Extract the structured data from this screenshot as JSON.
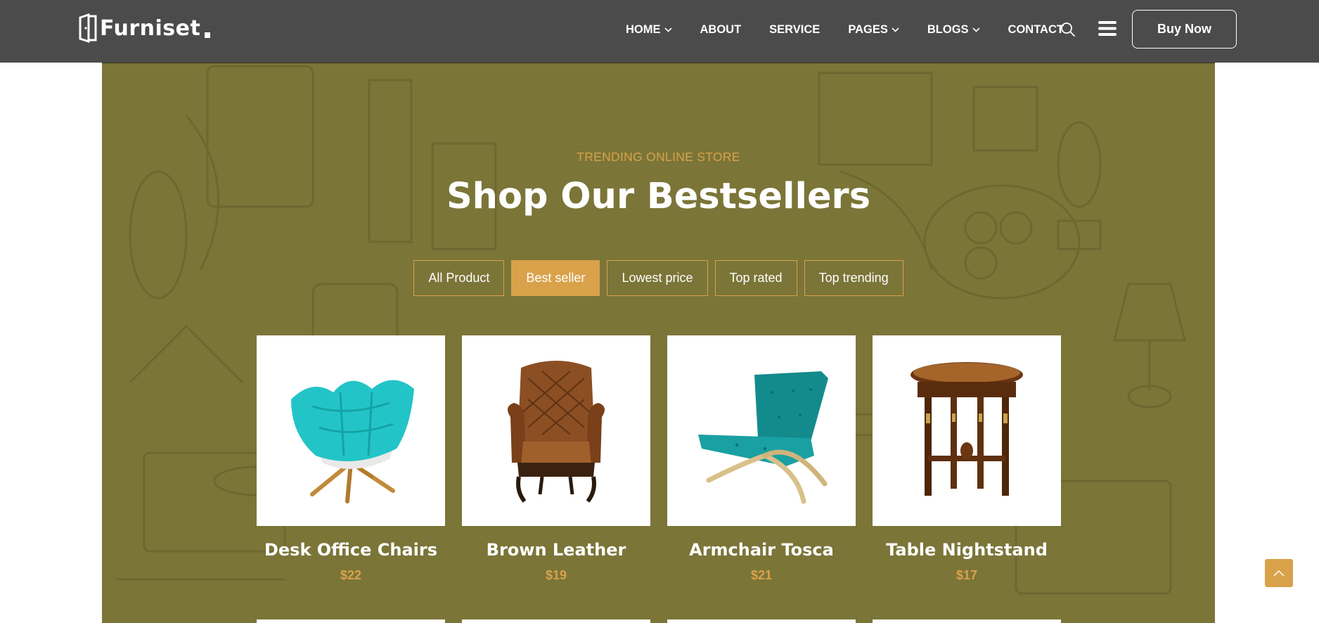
{
  "brand": {
    "name": "Furniset",
    "accent": "#d9a24a",
    "header_bg": "#4b4b4b",
    "section_bg": "#7b7538"
  },
  "nav": {
    "items": [
      {
        "label": "HOME",
        "has_dropdown": true
      },
      {
        "label": "ABOUT",
        "has_dropdown": false
      },
      {
        "label": "SERVICE",
        "has_dropdown": false
      },
      {
        "label": "PAGES",
        "has_dropdown": true
      },
      {
        "label": "BLOGS",
        "has_dropdown": true
      },
      {
        "label": "CONTACT",
        "has_dropdown": false
      }
    ],
    "icons": [
      "search-icon",
      "hamburger-menu-icon"
    ],
    "cta_label": "Buy Now"
  },
  "section": {
    "eyebrow": "TRENDING ONLINE STORE",
    "title": "Shop Our Bestsellers",
    "filters": [
      {
        "label": "All Product",
        "active": false
      },
      {
        "label": "Best seller",
        "active": true
      },
      {
        "label": "Lowest price",
        "active": false
      },
      {
        "label": "Top rated",
        "active": false
      },
      {
        "label": "Top trending",
        "active": false
      }
    ],
    "products": [
      {
        "name": "Desk Office Chairs",
        "price": "$22",
        "icon": "turquoise-lounge-chair"
      },
      {
        "name": "Brown Leather",
        "price": "$19",
        "icon": "leather-armchair"
      },
      {
        "name": "Armchair Tosca",
        "price": "$21",
        "icon": "teal-cantilever-chair"
      },
      {
        "name": "Table Nightstand",
        "price": "$17",
        "icon": "round-wooden-side-table"
      }
    ]
  },
  "scroll_top_icon": "chevron-up-icon"
}
